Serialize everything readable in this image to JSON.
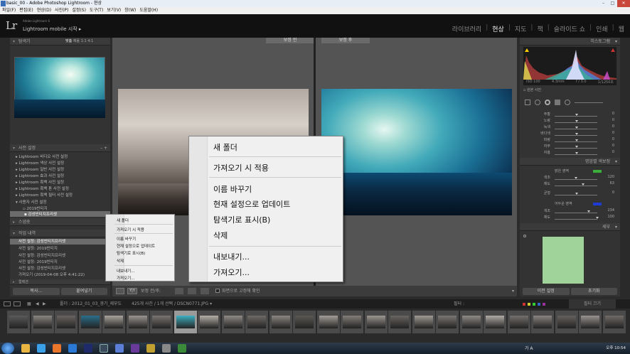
{
  "window": {
    "title": "basic_00 - Adobe Photoshop Lightroom - 현상"
  },
  "menubar": {
    "items": [
      "파일(F)",
      "편집(E)",
      "현상(D)",
      "사진(P)",
      "설정(S)",
      "도구(T)",
      "보기(V)",
      "창(W)",
      "도움말(H)"
    ]
  },
  "identity": {
    "small": "Adobe Lightroom 6",
    "main": "Lightroom mobile 시작 ▸",
    "logo": "Lr"
  },
  "modules": [
    "라이브러리",
    "현상",
    "지도",
    "책",
    "슬라이드 쇼",
    "인쇄",
    "웹"
  ],
  "active_module": "현상",
  "left": {
    "navigator": {
      "title": "탐색기",
      "zoom": [
        "맞춤",
        "채움",
        "1:1",
        "4:1"
      ]
    },
    "presets": {
      "title": "사전 설정",
      "items": [
        "Lightroom 비디오 사전 설정",
        "Lightroom 색상 사전 설정",
        "Lightroom 일반 사전 설정",
        "Lightroom 효과 사전 설정",
        "Lightroom 흑백 사전 설정",
        "Lightroom 흑백 톤 사전 설정",
        "Lightroom 흑백 필터 사전 설정",
        "사용자 사전 설정"
      ],
      "user_items": [
        "2019빈티지",
        "감성빈티지프리셋"
      ]
    },
    "snapshots": {
      "title": "스냅숏"
    },
    "history": {
      "title": "작업 내역",
      "items": [
        "사전 설정: 감성빈티지프리셋",
        "사전 설정: 2019빈티지",
        "사전 설정: 감성빈티지프리셋",
        "사전 설정: 2019빈티지",
        "사전 설정: 감성빈티지프리셋",
        "가져오기 (2019-04-08 오후 4:41:22)"
      ]
    },
    "collections": {
      "title": "컬렉션"
    },
    "copy_btn": "복사...",
    "paste_btn": "붙여넣기"
  },
  "center": {
    "before_label": "보정 전",
    "after_label": "보정 후",
    "toolbar_label": "보정 전/후:",
    "screen_label": "화면으로 고정해 확인"
  },
  "right": {
    "histogram_title": "히스토그램",
    "hist_info": [
      "ISO 100",
      "4.3mm",
      "f / 3.0",
      "1/1250초"
    ],
    "orig_photo": "원본 사진",
    "sliders": [
      {
        "label": "주황",
        "value": "0"
      },
      {
        "label": "노랑",
        "value": "0"
      },
      {
        "label": "녹색",
        "value": "0"
      },
      {
        "label": "바다색",
        "value": "0"
      },
      {
        "label": "파랑",
        "value": "0"
      },
      {
        "label": "자주",
        "value": "0"
      },
      {
        "label": "자홍",
        "value": "0"
      }
    ],
    "split_title": "명암별 색보정",
    "highlights": "밝은 영역",
    "hue": "색조",
    "sat": "채도",
    "balance": "균형",
    "shadows": "어두운 영역",
    "split_vals": [
      "120",
      "63",
      "0",
      "234",
      "100"
    ],
    "detail_title": "세부",
    "prev_btn": "이전 설정",
    "reset_btn": "초기화"
  },
  "filmstrip": {
    "path": "폴더 : 2012_01_03_경기_제부도",
    "count": "425개 사진 / 1개 선택 / DSCN0771.JPG ▾",
    "filter": "필터 :",
    "filter_off": "필터 끄기"
  },
  "context_small": {
    "items": [
      "새 폴더",
      "가져오기 시 적용",
      "이름 바꾸기",
      "현재 설정으로 업데이트",
      "탐색기로 표시(B)",
      "삭제",
      "내보내기...",
      "가져오기..."
    ]
  },
  "context_big": {
    "items": [
      "새 폴더",
      "가져오기 시 적용",
      "이름 바꾸기",
      "현재 설정으로 업데이트",
      "탐색기로 표시(B)",
      "삭제",
      "내보내기...",
      "가져오기..."
    ]
  },
  "taskbar": {
    "lang": "가 A",
    "time": "오후 10:54"
  },
  "colors": {
    "panel": "#333333",
    "selected": "#6c6c6c",
    "accent_green": "#3cae3c",
    "accent_blue": "#1c3bd8"
  }
}
